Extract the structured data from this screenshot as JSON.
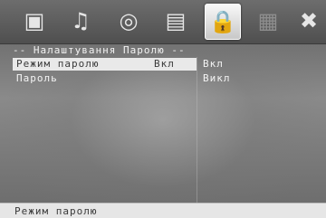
{
  "toolbar": {
    "tabs": [
      {
        "icon": "picture-icon",
        "glyph": "▣"
      },
      {
        "icon": "audio-icon",
        "glyph": "♫"
      },
      {
        "icon": "disc-icon",
        "glyph": "◎"
      },
      {
        "icon": "subtitle-icon",
        "glyph": "▤"
      },
      {
        "icon": "lock-icon",
        "glyph": "🔒"
      },
      {
        "icon": "parental-level-icon",
        "glyph": "▦"
      },
      {
        "icon": "exit-icon",
        "glyph": "✖"
      }
    ],
    "active_tab": 4
  },
  "panel": {
    "title": "-- Налаштування Паролю --"
  },
  "settings": [
    {
      "label": "Режим паролю",
      "value": "Вкл"
    },
    {
      "label": "Пароль",
      "value": ""
    }
  ],
  "options": [
    {
      "label": "Вкл"
    },
    {
      "label": "Викл"
    }
  ],
  "status": {
    "text": "Режим паролю"
  },
  "colors": {
    "highlight": "#e9e9e9",
    "text": "#f4f4f4",
    "toolbar": "#5a5a5a"
  }
}
